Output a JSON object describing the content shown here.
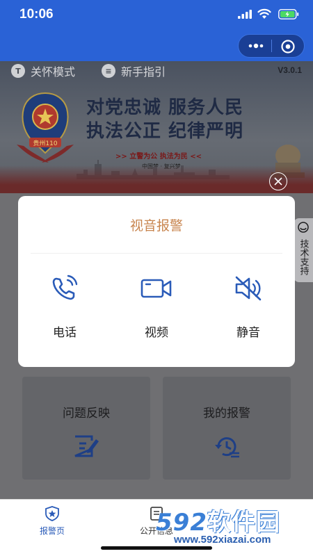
{
  "status_bar": {
    "time": "10:06"
  },
  "banner": {
    "toolbar": [
      {
        "label": "关怀模式",
        "icon": "care-mode-icon",
        "glyph": "T"
      },
      {
        "label": "新手指引",
        "icon": "guide-icon",
        "glyph": "≡"
      }
    ],
    "version": "V3.0.1",
    "slogan_line1": "对党忠诚  服务人民",
    "slogan_line2": "执法公正  纪律严明",
    "sub_line1": ">> 立警为公  执法为民 <<",
    "sub_line2": "中国梦 · 复兴梦",
    "badge_text": "贵州110"
  },
  "support_tab": {
    "label": "技术支持",
    "icon": "headset-icon"
  },
  "modal": {
    "title": "视音报警",
    "options": [
      {
        "label": "电话",
        "icon": "phone-icon"
      },
      {
        "label": "视频",
        "icon": "video-camera-icon"
      },
      {
        "label": "静音",
        "icon": "mute-icon"
      }
    ]
  },
  "cards": [
    {
      "label": "问题反映",
      "icon": "edit-form-icon"
    },
    {
      "label": "我的报警",
      "icon": "history-icon"
    }
  ],
  "tabbar": [
    {
      "label": "报警页",
      "icon": "shield-star-icon",
      "active": true
    },
    {
      "label": "公开信息",
      "icon": "document-icon",
      "active": false
    }
  ],
  "watermark": {
    "brand_num": "592",
    "brand_cn": "软件园",
    "url": "www.592xiazai.com"
  },
  "colors": {
    "primary": "#2a62d6",
    "modal_title": "#c8854f",
    "icon_blue": "#2a5bb8"
  }
}
